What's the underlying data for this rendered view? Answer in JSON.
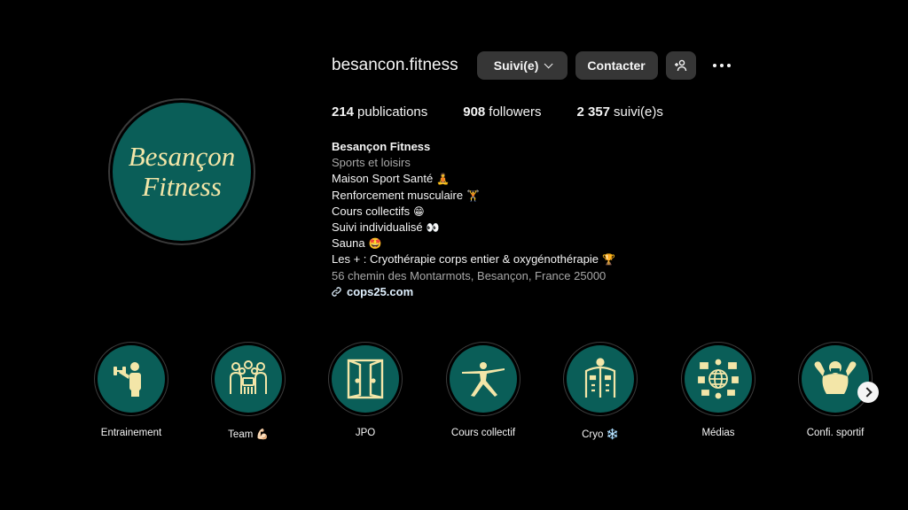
{
  "profile": {
    "username": "besancon.fitness",
    "avatar_text_line1": "Besançon",
    "avatar_text_line2": "Fitness",
    "follow_button": "Suivi(e)",
    "contact_button": "Contacter",
    "add_user_icon": "person-plus-icon",
    "more_icon": "more-dots-icon"
  },
  "stats": {
    "posts_count": "214",
    "posts_label": "publications",
    "followers_count": "908",
    "followers_label": "followers",
    "following_count": "2 357",
    "following_label": "suivi(e)s"
  },
  "bio": {
    "name": "Besançon Fitness",
    "category": "Sports et loisirs",
    "lines": [
      {
        "text": "Maison Sport Santé",
        "emoji": "🧘"
      },
      {
        "text": "Renforcement musculaire",
        "emoji": "🏋"
      },
      {
        "text": "Cours collectifs",
        "emoji": "😁"
      },
      {
        "text": "Suivi individualisé",
        "emoji": "👀"
      },
      {
        "text": "Sauna",
        "emoji": "🤩"
      },
      {
        "text": "Les + : Cryothérapie corps entier & oxygénothérapie",
        "emoji": "🏆"
      }
    ],
    "address": "56 chemin des Montarmots, Besançon, France 25000",
    "link": "cops25.com"
  },
  "highlights": [
    {
      "label": "Entrainement",
      "icon": "weightlifter-icon"
    },
    {
      "label": "Team 💪🏻",
      "icon": "team-group-icon"
    },
    {
      "label": "JPO",
      "icon": "open-doors-icon"
    },
    {
      "label": "Cours collectif",
      "icon": "yoga-pose-icon"
    },
    {
      "label": "Cryo ❄️",
      "icon": "cryo-cabin-icon"
    },
    {
      "label": "Médias",
      "icon": "media-globe-icon"
    },
    {
      "label": "Confi. sportif",
      "icon": "bodybuilder-icon"
    }
  ],
  "colors": {
    "brand_teal": "#0a5e58",
    "icon_cream": "#f3e6a8",
    "button_gray": "#363636"
  }
}
